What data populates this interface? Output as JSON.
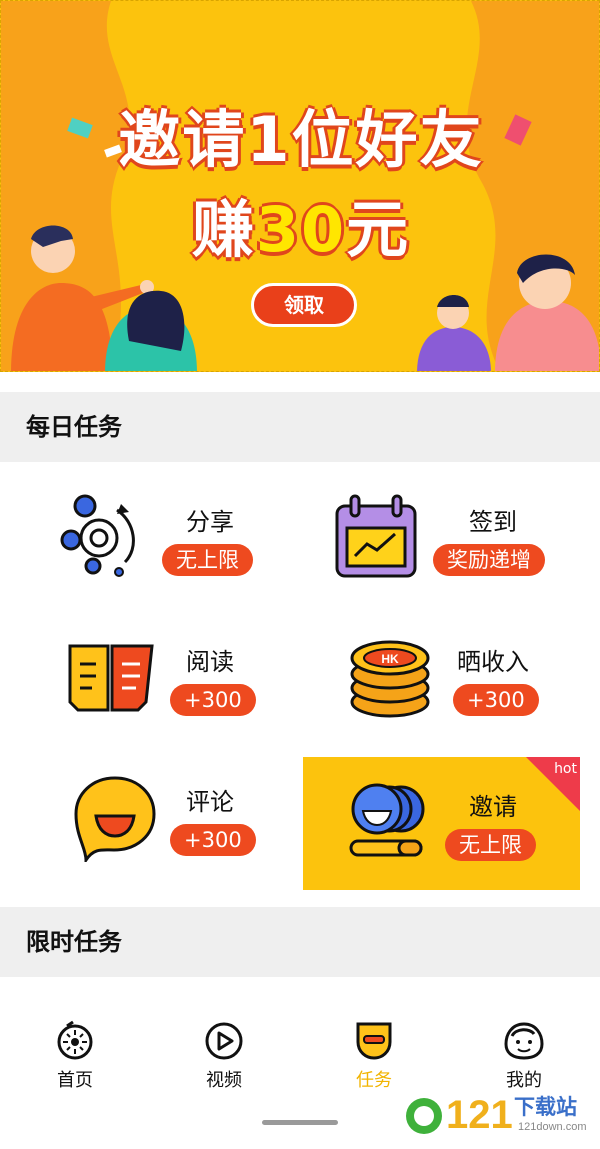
{
  "banner": {
    "line1": "邀请1位好友",
    "line2_prefix": "赚",
    "line2_amount": "30",
    "line2_suffix": "元",
    "claim_label": "领取"
  },
  "daily_tasks": {
    "title": "每日任务",
    "items": [
      {
        "label": "分享",
        "badge": "无上限",
        "icon": "share-orbit-icon"
      },
      {
        "label": "签到",
        "badge": "奖励递增",
        "icon": "calendar-checkin-icon"
      },
      {
        "label": "阅读",
        "badge": "+300",
        "icon": "open-book-icon"
      },
      {
        "label": "晒收入",
        "badge": "+300",
        "icon": "coin-stack-icon"
      },
      {
        "label": "评论",
        "badge": "+300",
        "icon": "chat-bubble-icon"
      },
      {
        "label": "邀请",
        "badge": "无上限",
        "icon": "invite-coins-icon",
        "hot": "hot"
      }
    ]
  },
  "limited_tasks": {
    "title": "限时任务"
  },
  "bottom_nav": [
    {
      "label": "首页",
      "icon": "home-kiwi-icon"
    },
    {
      "label": "视频",
      "icon": "video-play-icon"
    },
    {
      "label": "任务",
      "icon": "task-mask-icon",
      "active": true
    },
    {
      "label": "我的",
      "icon": "profile-face-icon"
    }
  ],
  "watermark": {
    "number": "121",
    "text": "下载站",
    "sub": "121down.com"
  },
  "colors": {
    "banner_bg": "#fcc30d",
    "accent_red": "#ee4a1f",
    "active_nav": "#f2b400",
    "section_bg": "#efefef",
    "hot_tag": "#ee3b4a"
  }
}
